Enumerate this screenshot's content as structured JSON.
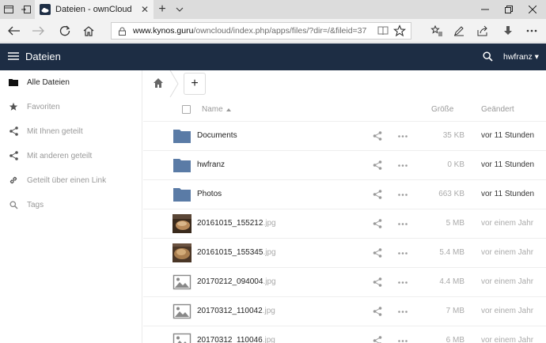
{
  "browser": {
    "tab_title": "Dateien - ownCloud",
    "url_host": "www.kynos.guru",
    "url_path": "/owncloud/index.php/apps/files/?dir=/&fileid=37"
  },
  "header": {
    "app_title": "Dateien",
    "user": "hwfranz",
    "color": "#1d2d44"
  },
  "sidebar": {
    "items": [
      {
        "label": "Alle Dateien",
        "icon": "folder-icon",
        "active": true
      },
      {
        "label": "Favoriten",
        "icon": "star-icon",
        "active": false
      },
      {
        "label": "Mit Ihnen geteilt",
        "icon": "share-icon",
        "active": false
      },
      {
        "label": "Mit anderen geteilt",
        "icon": "share-icon",
        "active": false
      },
      {
        "label": "Geteilt über einen Link",
        "icon": "link-icon",
        "active": false
      },
      {
        "label": "Tags",
        "icon": "tag-icon",
        "active": false
      }
    ]
  },
  "table": {
    "col_name": "Name",
    "col_size": "Größe",
    "col_modified": "Geändert",
    "rows": [
      {
        "name": "Documents",
        "ext": "",
        "type": "folder",
        "size": "35 KB",
        "modified": "vor 11 Stunden"
      },
      {
        "name": "hwfranz",
        "ext": "",
        "type": "folder",
        "size": "0 KB",
        "modified": "vor 11 Stunden"
      },
      {
        "name": "Photos",
        "ext": "",
        "type": "folder",
        "size": "663 KB",
        "modified": "vor 11 Stunden"
      },
      {
        "name": "20161015_155212",
        "ext": ".jpg",
        "type": "photo",
        "size": "5 MB",
        "modified": "vor einem Jahr"
      },
      {
        "name": "20161015_155345",
        "ext": ".jpg",
        "type": "photo",
        "size": "5.4 MB",
        "modified": "vor einem Jahr"
      },
      {
        "name": "20170212_094004",
        "ext": ".jpg",
        "type": "image",
        "size": "4.4 MB",
        "modified": "vor einem Jahr"
      },
      {
        "name": "20170312_110042",
        "ext": ".jpg",
        "type": "image",
        "size": "7 MB",
        "modified": "vor einem Jahr"
      },
      {
        "name": "20170312_110046",
        "ext": ".jpg",
        "type": "image",
        "size": "6 MB",
        "modified": "vor einem Jahr"
      }
    ]
  }
}
